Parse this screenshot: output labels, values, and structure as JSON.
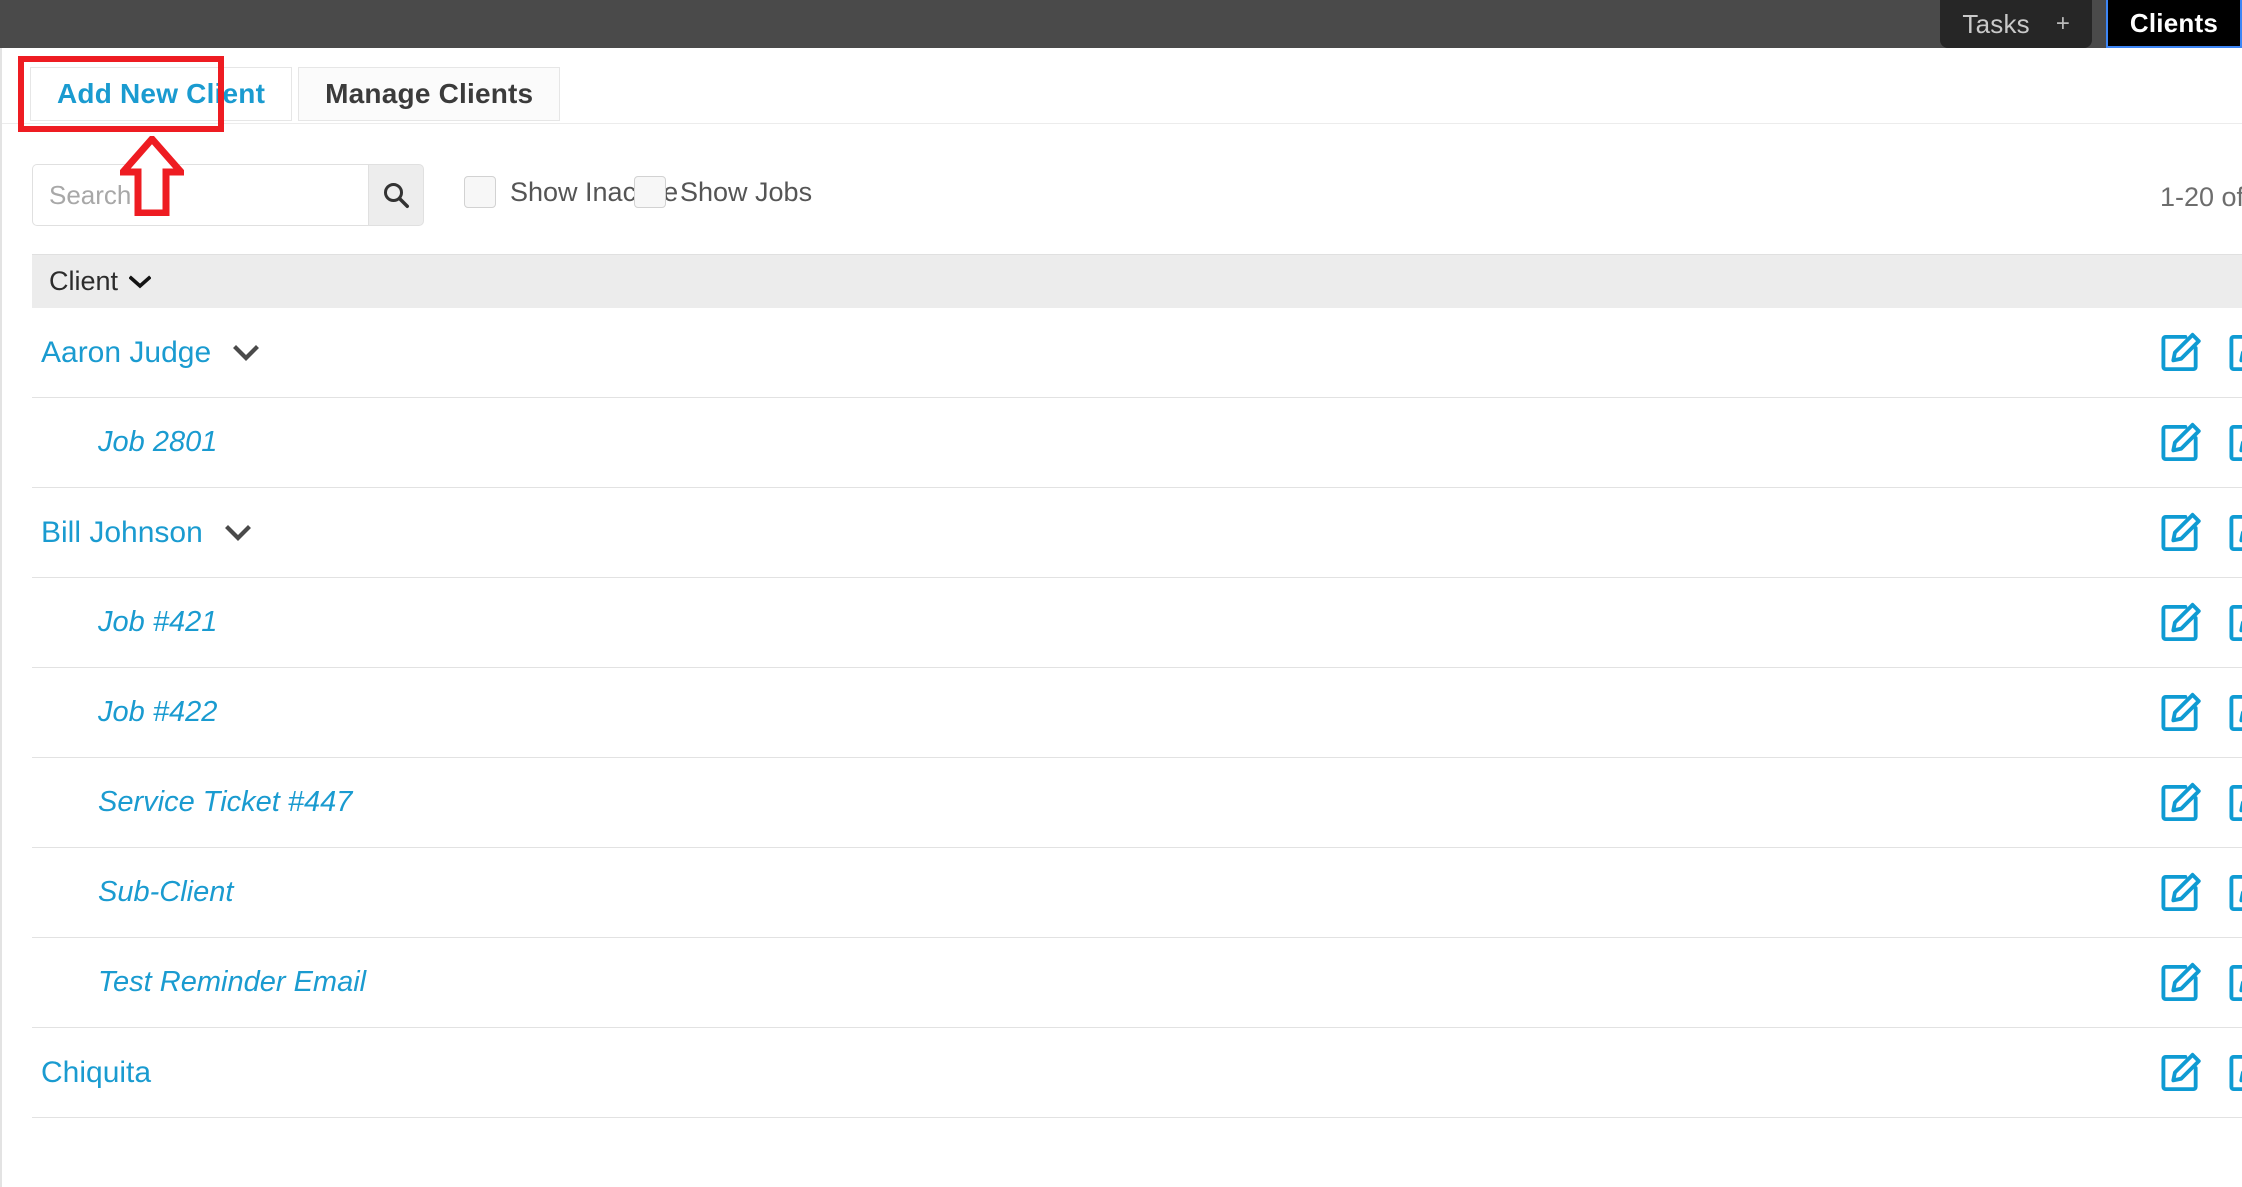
{
  "topnav": {
    "tasks_label": "Tasks",
    "tasks_plus": "+",
    "clients_label": "Clients"
  },
  "tabs": {
    "add_new_client": "Add New Client",
    "manage_clients": "Manage Clients"
  },
  "filters": {
    "search_placeholder": "Search",
    "search_value": "",
    "show_inactive_label": "Show Inactive",
    "show_jobs_label": "Show Jobs",
    "pagination_text": "1-20 of"
  },
  "table": {
    "header_client": "Client",
    "rows": [
      {
        "label": "Aaron Judge",
        "type": "client",
        "has_caret": true
      },
      {
        "label": "Job 2801",
        "type": "job",
        "has_caret": false
      },
      {
        "label": "Bill Johnson",
        "type": "client",
        "has_caret": true
      },
      {
        "label": "Job #421",
        "type": "job",
        "has_caret": false
      },
      {
        "label": "Job #422",
        "type": "job",
        "has_caret": false
      },
      {
        "label": "Service Ticket #447",
        "type": "job",
        "has_caret": false
      },
      {
        "label": "Sub-Client",
        "type": "job",
        "has_caret": false
      },
      {
        "label": "Test Reminder Email",
        "type": "job",
        "has_caret": false
      },
      {
        "label": "Chiquita",
        "type": "client",
        "has_caret": false
      }
    ]
  },
  "colors": {
    "link_blue": "#1a9bd0",
    "topbar_gray": "#4a4a4a",
    "annotation_red": "#ee1c22",
    "focus_blue": "#3d86f5"
  },
  "icons": {
    "search": "search-icon",
    "caret": "chevron-down-icon",
    "edit": "edit-pencil-icon",
    "annotation_arrow": "up-arrow-annotation-icon"
  }
}
